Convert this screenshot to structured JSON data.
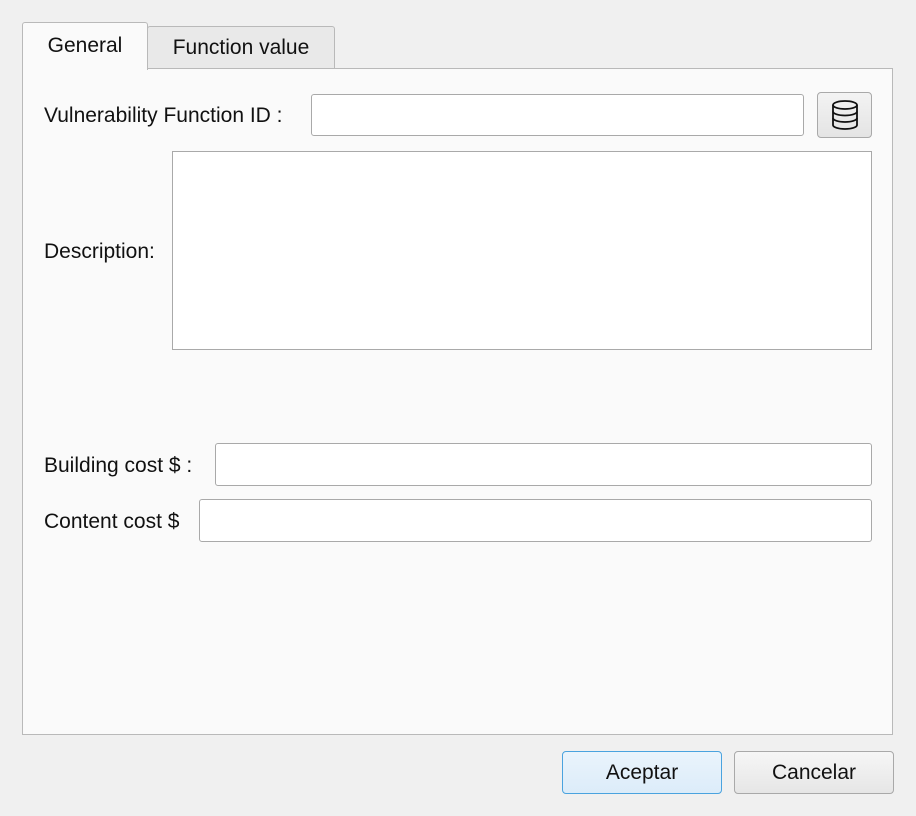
{
  "tabs": {
    "general": "General",
    "function_value": "Function value"
  },
  "form": {
    "vulnerability_id_label": "Vulnerability Function ID :",
    "vulnerability_id_value": "",
    "database_button_icon": "database-icon",
    "description_label": "Description:",
    "description_value": "",
    "building_cost_label": "Building cost $ :",
    "building_cost_value": "",
    "content_cost_label": "Content cost $",
    "content_cost_value": ""
  },
  "buttons": {
    "accept": "Aceptar",
    "cancel": "Cancelar"
  },
  "colors": {
    "accent": "#4aa3df"
  }
}
